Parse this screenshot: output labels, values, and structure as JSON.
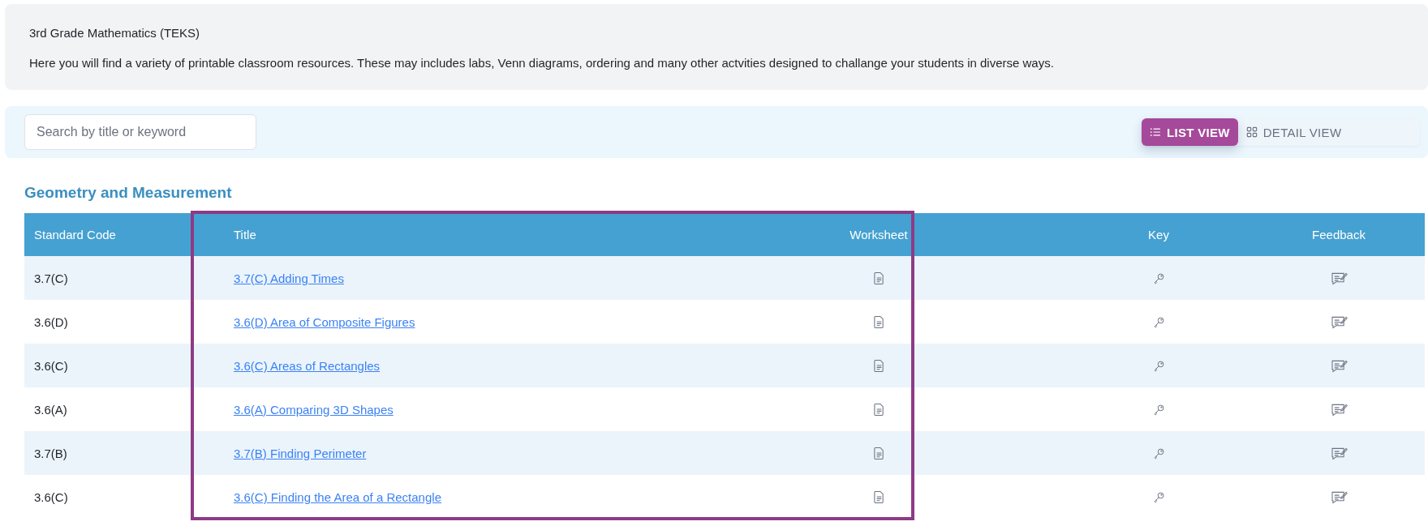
{
  "header": {
    "title": "3rd Grade Mathematics (TEKS)",
    "description": "Here you will find a variety of printable classroom resources. These may includes labs, Venn diagrams, ordering and many other actvities designed to challange your students in diverse ways."
  },
  "search": {
    "placeholder": "Search by title or keyword"
  },
  "view_toggle": [
    {
      "label": "LIST VIEW",
      "kind": "list",
      "selected": true
    },
    {
      "label": "DETAIL VIEW",
      "kind": "grid",
      "selected": false
    }
  ],
  "section": {
    "heading": "Geometry and Measurement",
    "table": {
      "columns": [
        "Standard Code",
        "Title",
        "Worksheet",
        "Key",
        "Feedback"
      ],
      "rows": [
        {
          "code": "3.7(C)",
          "title": "3.7(C) Adding Times"
        },
        {
          "code": "3.6(D)",
          "title": "3.6(D) Area of Composite Figures"
        },
        {
          "code": "3.6(C)",
          "title": "3.6(C) Areas of Rectangles"
        },
        {
          "code": "3.6(A)",
          "title": "3.6(A) Comparing 3D Shapes"
        },
        {
          "code": "3.7(B)",
          "title": "3.7(B) Finding Perimeter"
        },
        {
          "code": "3.6(C)",
          "title": "3.6(C) Finding the Area of a Rectangle"
        }
      ]
    }
  }
}
